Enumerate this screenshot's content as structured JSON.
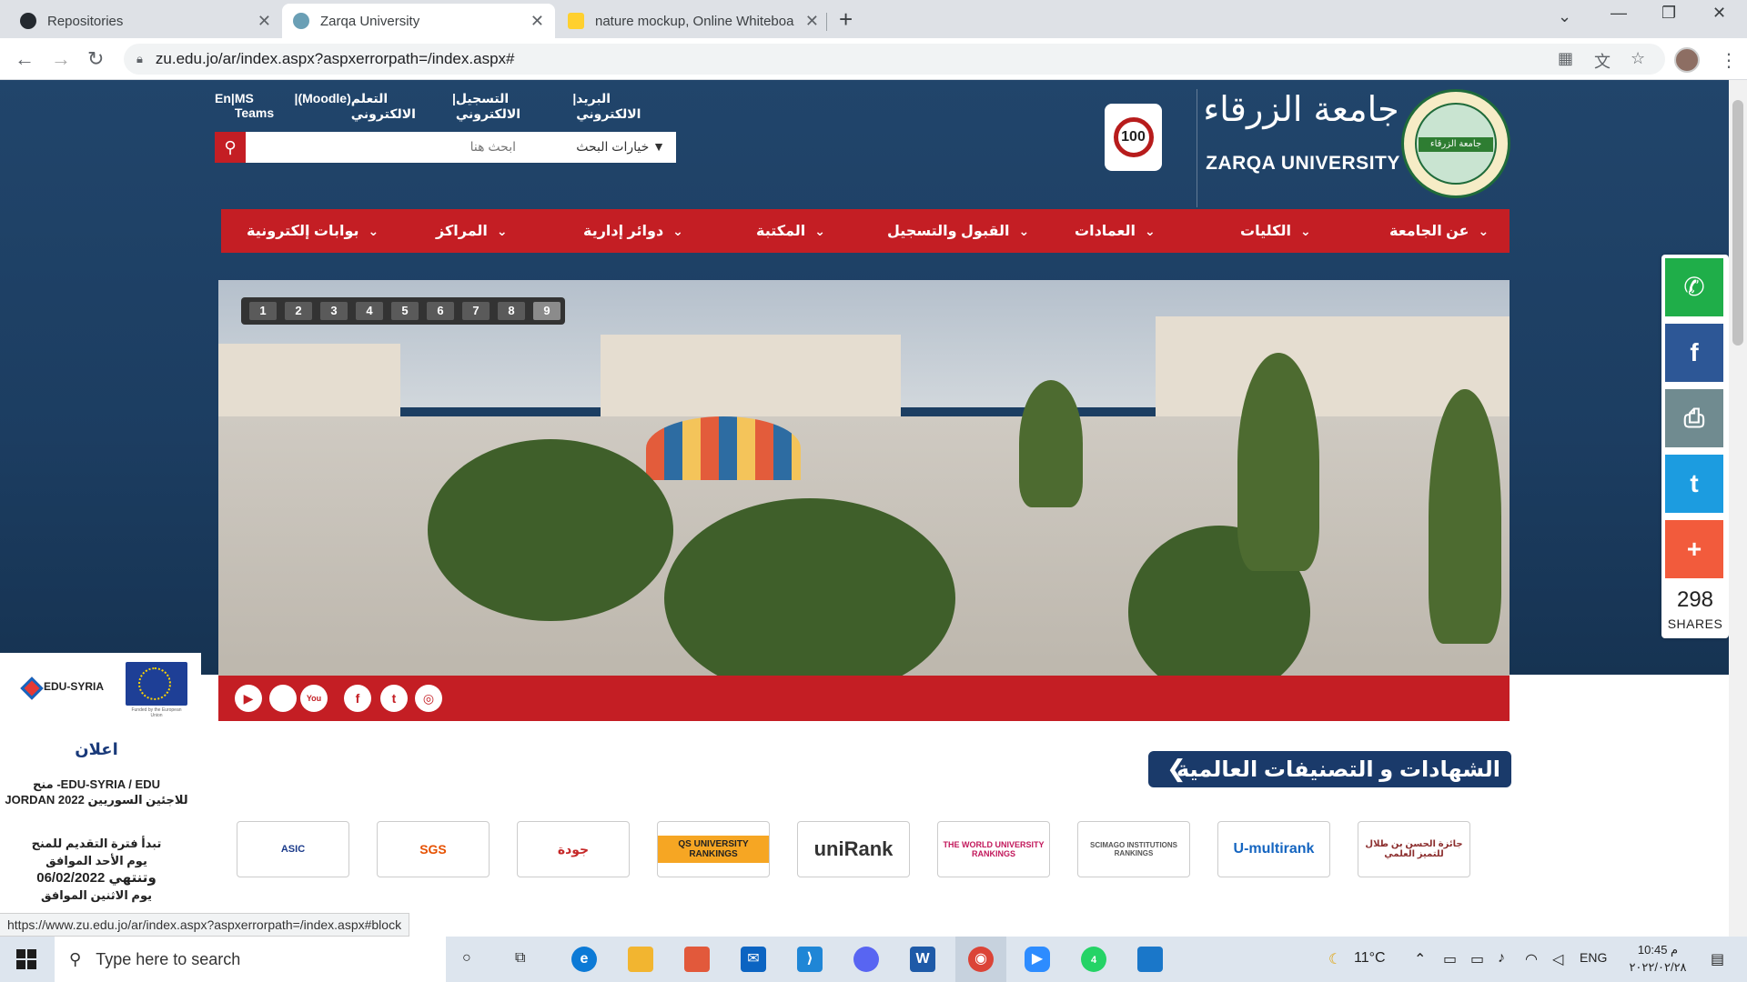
{
  "browser": {
    "tabs": [
      {
        "title": "Repositories",
        "active": false,
        "icon": "github-icon"
      },
      {
        "title": "Zarqa University",
        "active": true,
        "icon": "zarqa-favicon-icon"
      },
      {
        "title": "nature mockup, Online Whiteboa",
        "active": false,
        "icon": "miro-icon"
      }
    ],
    "new_tab": "+",
    "close_glyph": "✕",
    "url": "zu.edu.jo/ar/index.aspx?aspxerrorpath=/index.aspx#",
    "status_url": "https://www.zu.edu.jo/ar/index.aspx?aspxerrorpath=/index.aspx#block"
  },
  "header": {
    "top_links": [
      "En",
      "|",
      "MS Teams",
      "|",
      "(Moodle)",
      "التعلم الالكتروني",
      "|",
      "التسجيل الالكتروني",
      "|",
      "البريد الالكتروني"
    ],
    "search_placeholder": "ابحث هنا",
    "search_options": "خيارات البحث",
    "badge_100": "100",
    "university_name_ar": "جامعة الزرقاء",
    "university_name_en": "ZARQA UNIVERSITY",
    "seal_text": "جامعة الزرقاء"
  },
  "nav": {
    "items": [
      {
        "label": "عن الجامعة",
        "has_menu": true
      },
      {
        "label": "الكليات",
        "has_menu": true
      },
      {
        "label": "العمادات",
        "has_menu": true
      },
      {
        "label": "القبول والتسجيل",
        "has_menu": true
      },
      {
        "label": "المكتبة",
        "has_menu": true
      },
      {
        "label": "دوائر إدارية",
        "has_menu": true
      },
      {
        "label": "المراكز",
        "has_menu": true
      },
      {
        "label": "بوابات إلكترونية",
        "has_menu": true
      }
    ]
  },
  "slider": {
    "pages": [
      "1",
      "2",
      "3",
      "4",
      "5",
      "6",
      "7",
      "8",
      "9"
    ],
    "active_page": "9"
  },
  "social": {
    "icons": [
      "play-store-icon",
      "apple-icon",
      "youtube-icon",
      "facebook-icon",
      "twitter-icon",
      "instagram-icon"
    ],
    "labels": [
      "▶",
      "",
      "You",
      "f",
      "t",
      "◎"
    ]
  },
  "share": {
    "buttons": [
      {
        "name": "whatsapp-share-button",
        "color": "#1fae49",
        "glyph": "✆"
      },
      {
        "name": "facebook-share-button",
        "color": "#2d5796",
        "glyph": "f"
      },
      {
        "name": "print-share-button",
        "color": "#708b90",
        "glyph": "⎙"
      },
      {
        "name": "twitter-share-button",
        "color": "#1c9ce0",
        "glyph": "t"
      },
      {
        "name": "more-share-button",
        "color": "#f25b3c",
        "glyph": "+"
      }
    ],
    "count": "298",
    "label": "SHARES"
  },
  "side_ad": {
    "brand": "EDU-SYRIA",
    "eu_caption": "Funded by the European Union",
    "title": "اعلان",
    "subtitle_line1": "منح -EDU-SYRIA / EDU",
    "subtitle_line2": "JORDAN للاجئين السوريين 2022",
    "body": [
      "تبدأ فترة التقديم للمنح",
      "يوم الأحد الموافق",
      "06/02/2022 وتنتهي",
      "يوم الاثنين الموافق"
    ]
  },
  "rankings": {
    "title": "الشهادات و التصنيفات العالمية",
    "logos": [
      "ASIC",
      "SGS",
      "جودة",
      "QS UNIVERSITY RANKINGS",
      "uniRank",
      "THE WORLD UNIVERSITY RANKINGS",
      "SCIMAGO INSTITUTIONS RANKINGS",
      "U-multirank",
      "جائزة الحسن بن طلال للتميز العلمي"
    ]
  },
  "taskbar": {
    "search_placeholder": "Type here to search",
    "temperature": "11°C",
    "language": "ENG",
    "time": "10:45 م",
    "date": "٢٠٢٢/٠٢/٢٨",
    "notification_count": "4"
  },
  "colors": {
    "header_blue": "#21456b",
    "nav_red": "#c41e24",
    "rank_navy": "#1a3a6a"
  }
}
